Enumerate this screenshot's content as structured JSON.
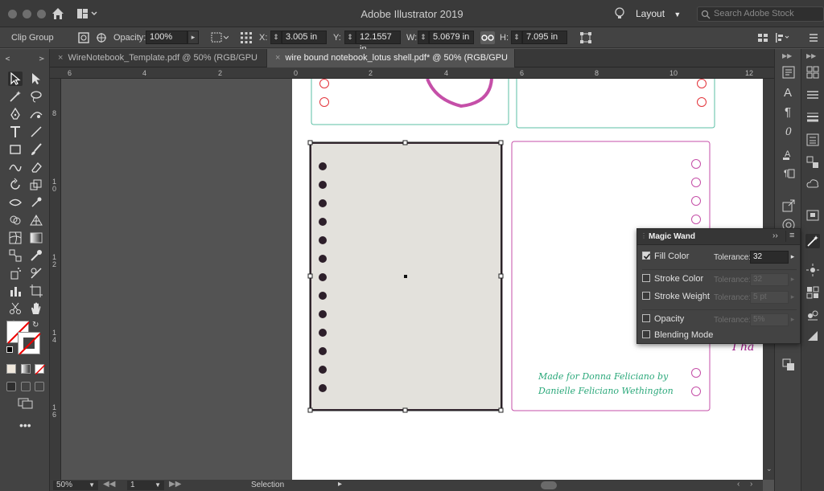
{
  "app": {
    "title": "Adobe Illustrator 2019",
    "workspace_label": "Layout",
    "search_placeholder": "Search Adobe Stock"
  },
  "control_bar": {
    "selection_type": "Clip Group",
    "opacity_label": "Opacity:",
    "opacity_value": "100%",
    "x_label": "X:",
    "x_value": "3.005 in",
    "y_label": "Y:",
    "y_value": "12.1557 in",
    "w_label": "W:",
    "w_value": "5.0679 in",
    "h_label": "H:",
    "h_value": "7.095 in"
  },
  "tabs": [
    {
      "label": "WireNotebook_Template.pdf @ 50% (RGB/GPU Preview)",
      "active": false
    },
    {
      "label": "wire bound notebook_lotus shell.pdf* @ 50% (RGB/GPU Preview)",
      "active": true
    }
  ],
  "rulers": {
    "horizontal": [
      "6",
      "4",
      "2",
      "0",
      "2",
      "4",
      "6",
      "8",
      "10",
      "12"
    ],
    "vertical": [
      "8",
      "1 0",
      "1 2",
      "1 4",
      "1 6"
    ]
  },
  "artwork": {
    "credit_line1": "Made for Donna Feliciano by",
    "credit_line2": "Danielle Feliciano Wethington",
    "partial_text": "I ha",
    "teal": "#5bbfa6",
    "magenta": "#c54fa8",
    "red": "#e3343b",
    "credit_color": "#2aa87a"
  },
  "magic_wand_panel": {
    "title": "Magic Wand",
    "options": [
      {
        "label": "Fill Color",
        "checked": true,
        "tolerance_label": "Tolerance:",
        "tolerance": "32",
        "enabled": true
      },
      {
        "label": "Stroke Color",
        "checked": false,
        "tolerance_label": "Tolerance:",
        "tolerance": "32",
        "enabled": false
      },
      {
        "label": "Stroke Weight",
        "checked": false,
        "tolerance_label": "Tolerance:",
        "tolerance": "5 pt",
        "enabled": false
      },
      {
        "label": "Opacity",
        "checked": false,
        "tolerance_label": "Tolerance:",
        "tolerance": "5%",
        "enabled": false
      },
      {
        "label": "Blending Mode",
        "checked": false
      }
    ]
  },
  "status_bar": {
    "zoom": "50%",
    "page": "1",
    "tool": "Selection"
  }
}
